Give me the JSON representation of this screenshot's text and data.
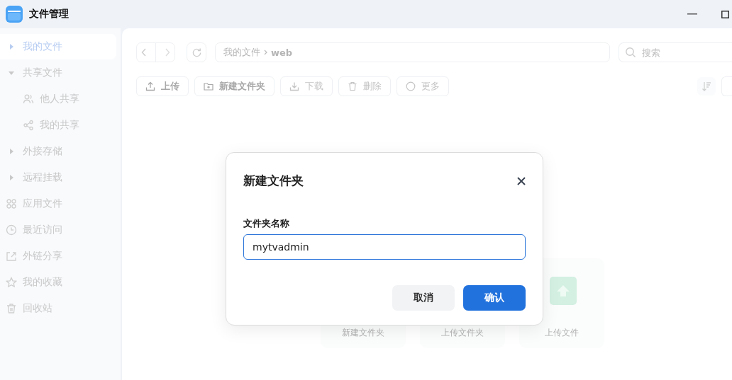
{
  "window": {
    "title": "文件管理"
  },
  "sidebar": {
    "items": [
      {
        "label": "我的文件",
        "kind": "tree",
        "expanded": false,
        "selected": true
      },
      {
        "label": "共享文件",
        "kind": "tree",
        "expanded": true,
        "selected": false,
        "children": [
          {
            "label": "他人共享",
            "kind": "people",
            "selected": false
          },
          {
            "label": "我的共享",
            "kind": "share",
            "selected": false
          }
        ]
      },
      {
        "label": "外接存储",
        "kind": "tree",
        "expanded": false,
        "selected": false
      },
      {
        "label": "远程挂载",
        "kind": "tree",
        "expanded": false,
        "selected": false
      },
      {
        "label": "应用文件",
        "kind": "apps",
        "selected": false
      },
      {
        "label": "最近访问",
        "kind": "clock",
        "selected": false
      },
      {
        "label": "外链分享",
        "kind": "link",
        "selected": false
      },
      {
        "label": "我的收藏",
        "kind": "star",
        "selected": false
      },
      {
        "label": "回收站",
        "kind": "trash",
        "selected": false
      }
    ]
  },
  "path": {
    "segments": [
      "我的文件",
      "web"
    ]
  },
  "search": {
    "placeholder": "搜索"
  },
  "toolbar": [
    {
      "label": "上传",
      "kind": "upload",
      "disabled": false
    },
    {
      "label": "新建文件夹",
      "kind": "folder",
      "disabled": false
    },
    {
      "label": "下载",
      "kind": "download",
      "disabled": true
    },
    {
      "label": "删除",
      "kind": "trash",
      "disabled": true
    },
    {
      "label": "更多",
      "kind": "more",
      "disabled": true
    }
  ],
  "empty_actions": [
    {
      "label": "新建文件夹",
      "kind": "folder"
    },
    {
      "label": "上传文件夹",
      "kind": "folder-upload"
    },
    {
      "label": "上传文件",
      "kind": "upload"
    }
  ],
  "dialog": {
    "title": "新建文件夹",
    "field_label": "文件夹名称",
    "value": "mytvadmin",
    "buttons": [
      {
        "label": "取消",
        "kind": "secondary"
      },
      {
        "label": "确认",
        "kind": "primary"
      }
    ]
  }
}
